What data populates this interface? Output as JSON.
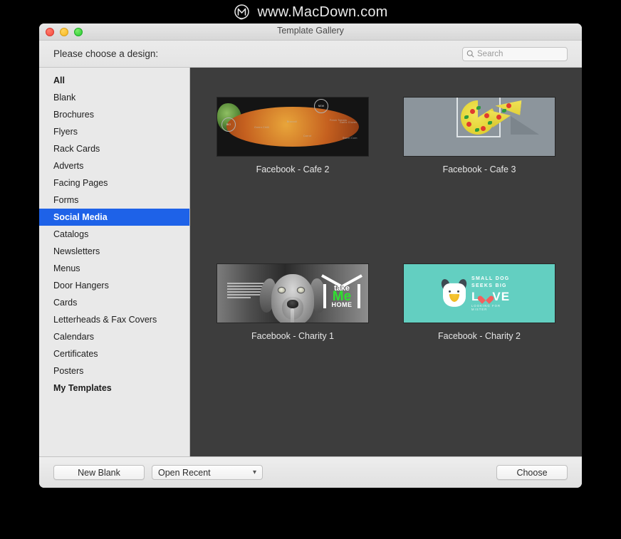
{
  "banner": {
    "brand": "www.MacDown.com",
    "logo_icon": "macdown-circle-m-logo"
  },
  "window": {
    "title": "Template Gallery",
    "traffic_lights": [
      "close-red",
      "minimize-yellow",
      "zoom-green"
    ]
  },
  "header": {
    "prompt": "Please choose a design:",
    "search": {
      "placeholder": "Search",
      "value": "",
      "icon": "search-icon"
    }
  },
  "sidebar": {
    "items": [
      {
        "label": "All",
        "bold": true,
        "selected": false
      },
      {
        "label": "Blank",
        "bold": false,
        "selected": false
      },
      {
        "label": "Brochures",
        "bold": false,
        "selected": false
      },
      {
        "label": "Flyers",
        "bold": false,
        "selected": false
      },
      {
        "label": "Rack Cards",
        "bold": false,
        "selected": false
      },
      {
        "label": "Adverts",
        "bold": false,
        "selected": false
      },
      {
        "label": "Facing Pages",
        "bold": false,
        "selected": false
      },
      {
        "label": "Forms",
        "bold": false,
        "selected": false
      },
      {
        "label": "Social Media",
        "bold": true,
        "selected": true
      },
      {
        "label": "Catalogs",
        "bold": false,
        "selected": false
      },
      {
        "label": "Newsletters",
        "bold": false,
        "selected": false
      },
      {
        "label": "Menus",
        "bold": false,
        "selected": false
      },
      {
        "label": "Door Hangers",
        "bold": false,
        "selected": false
      },
      {
        "label": "Cards",
        "bold": false,
        "selected": false
      },
      {
        "label": "Letterheads & Fax Covers",
        "bold": false,
        "selected": false
      },
      {
        "label": "Calendars",
        "bold": false,
        "selected": false
      },
      {
        "label": "Certificates",
        "bold": false,
        "selected": false
      },
      {
        "label": "Posters",
        "bold": false,
        "selected": false
      },
      {
        "label": "My Templates",
        "bold": true,
        "selected": false
      }
    ],
    "selection_color": "#1e62e8"
  },
  "gallery": {
    "background_color": "#3d3d3d",
    "templates": [
      {
        "label": "Facebook - Cafe 2",
        "style": "dark-food-photo"
      },
      {
        "label": "Facebook - Cafe 3",
        "style": "gray-pizza-box"
      },
      {
        "label": "Facebook - Charity 1",
        "style": "bw-dog-take-me-home"
      },
      {
        "label": "Facebook - Charity 2",
        "style": "teal-small-dog-love"
      }
    ]
  },
  "thumb_art": {
    "cafe2_chalk": [
      "Fresh Tomato",
      "Sweet Corn",
      "Green Chilli",
      "Broccoli",
      "Garlic Cloves",
      "Carrot",
      "Lettuce"
    ],
    "cafe2_badges": [
      "BIO",
      "NEW"
    ],
    "charity1": {
      "word_top": "take",
      "word_mid": "Me",
      "word_bottom": "HOME",
      "accent_color": "#2fe02f"
    },
    "charity2": {
      "line1": "SMALL DOG",
      "line2": "SEEKS BIG",
      "line3_before": "L",
      "line3_after": "VE",
      "line4": "LOOKING FOR MISTER",
      "background_color": "#63cfc1",
      "heart_color": "#f2605f"
    }
  },
  "footer": {
    "new_blank_label": "New Blank",
    "open_recent_label": "Open Recent",
    "open_recent_chevron": "chevron-down-icon",
    "choose_label": "Choose"
  }
}
